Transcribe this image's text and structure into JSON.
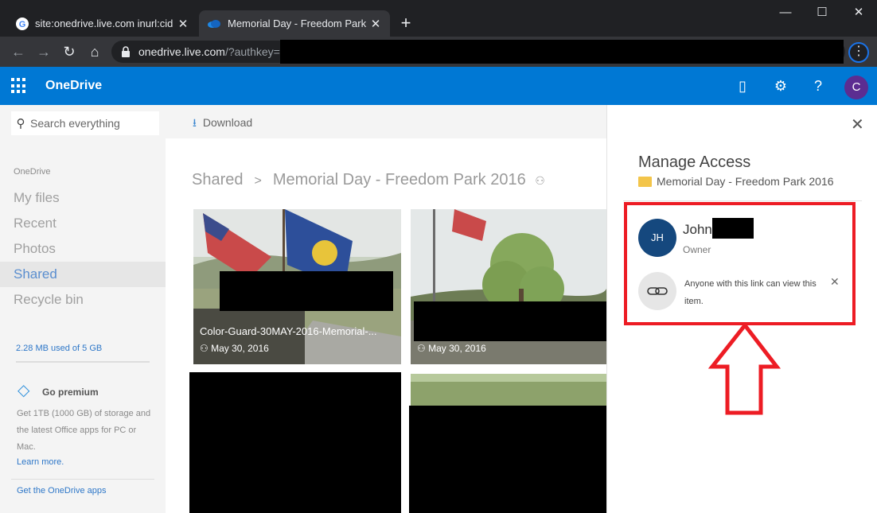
{
  "browser": {
    "tabs": [
      {
        "title": "site:onedrive.live.com inurl:cid Me",
        "favicon": "google-icon"
      },
      {
        "title": "Memorial Day - Freedom Park 2016",
        "favicon": "onedrive-icon",
        "active": true
      }
    ],
    "url_host": "onedrive.live.com",
    "url_path": "/?authkey="
  },
  "app": {
    "name": "OneDrive",
    "accent": "#0078d4",
    "avatar_initial": "C"
  },
  "sidebar": {
    "search_placeholder": "Search everything",
    "group_label": "OneDrive",
    "items": [
      {
        "label": "My files"
      },
      {
        "label": "Recent"
      },
      {
        "label": "Photos"
      },
      {
        "label": "Shared",
        "active": true
      },
      {
        "label": "Recycle bin"
      }
    ],
    "storage": "2.28 MB used of 5 GB",
    "premium_title": "Go premium",
    "premium_desc": "Get 1TB (1000 GB) of storage and the latest Office apps for PC or Mac.",
    "learn_more": "Learn more.",
    "get_apps": "Get the OneDrive apps"
  },
  "main": {
    "command_download": "Download",
    "breadcrumb": {
      "root": "Shared",
      "separator": ">",
      "current": "Memorial Day - Freedom Park 2016"
    },
    "tiles": [
      {
        "name": "Color-Guard-30MAY-2016-Memorial-...",
        "date": "May 30, 2016"
      },
      {
        "name": "",
        "date": "May 30, 2016"
      }
    ]
  },
  "panel": {
    "title": "Manage Access",
    "folder": "Memorial Day - Freedom Park 2016",
    "owner_initials": "JH",
    "owner_name": "John",
    "owner_role": "Owner",
    "link_text": "Anyone with this link can view this item."
  }
}
